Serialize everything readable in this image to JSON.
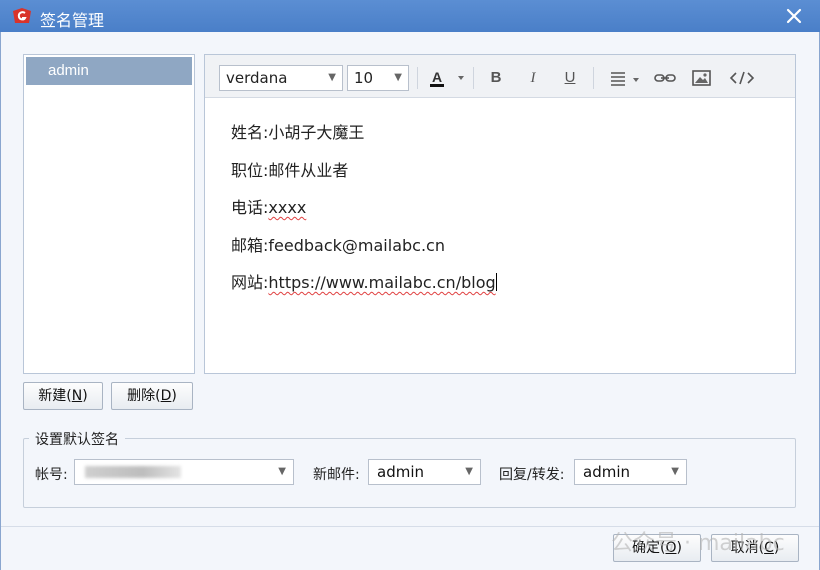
{
  "window": {
    "title": "签名管理",
    "logo_icon": "app-logo-icon",
    "close_icon": "close-icon",
    "accent_color": "#4a7fc8"
  },
  "signature_list": {
    "items": [
      {
        "label": "admin",
        "selected": true
      }
    ]
  },
  "editor": {
    "toolbar": {
      "font_family": "verdana",
      "font_size": "10",
      "buttons": [
        "font-color-icon",
        "bold-icon",
        "italic-icon",
        "underline-icon",
        "align-icon",
        "link-icon",
        "image-icon",
        "source-code-icon"
      ]
    },
    "lines": [
      {
        "label": "姓名:",
        "value": "小胡子大魔王"
      },
      {
        "label": "职位:",
        "value": "邮件从业者"
      },
      {
        "label": "电话:",
        "value": "xxxx"
      },
      {
        "label": "邮箱:",
        "value": "feedback@mailabc.cn"
      },
      {
        "label": "网站:",
        "value": "https://www.mailabc.cn/blog"
      }
    ]
  },
  "buttons": {
    "new_label": "新建(",
    "new_key": "N",
    "delete_label": "删除(",
    "delete_key": "D",
    "close_paren": ")",
    "ok_label": "确定(",
    "ok_key": "O",
    "cancel_label": "取消(",
    "cancel_key": "C"
  },
  "default_signature": {
    "group_title": "设置默认签名",
    "account_label": "帐号:",
    "new_mail_label": "新邮件:",
    "new_mail_value": "admin",
    "reply_forward_label": "回复/转发:",
    "reply_forward_value": "admin"
  },
  "watermark": "公众号 · mailabc"
}
